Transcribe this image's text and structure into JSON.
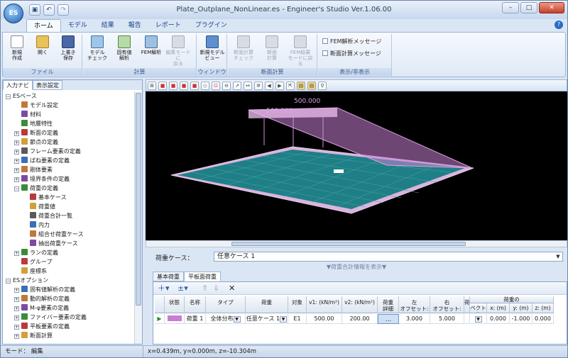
{
  "app": {
    "icon": "ES",
    "title": "Plate_Outplane_NonLinear.es - Engineer's Studio Ver.1.06.00"
  },
  "window_controls": {
    "minimize": "–",
    "maximize": "□",
    "close": "✕"
  },
  "quick_access": [
    "save-icon",
    "undo-icon",
    "redo-icon"
  ],
  "tabs": [
    "ホーム",
    "モデル",
    "結果",
    "報告",
    "レポート",
    "プラグイン"
  ],
  "ribbon": {
    "file": {
      "caption": "ファイル",
      "new": "新規\n作成",
      "open": "開く",
      "save": "上書き\n保存"
    },
    "calc": {
      "caption": "計算",
      "model_check": "モデル\nチェック",
      "eigen": "固有値\n解析",
      "fem": "FEM解析",
      "back_edit": "編集モードに\n戻る"
    },
    "window": {
      "caption": "ウィンドウ",
      "new_view": "新規モデル\nビュー"
    },
    "section": {
      "caption": "断面計算",
      "check": "断面計算\nチェック",
      "calc": "断面\n計算",
      "fem_back": "FEM結果\nモードに戻る"
    },
    "display": {
      "caption": "表示/非表示",
      "fem_msg": "FEM解析メッセージ",
      "sec_msg": "断面計算メッセージ"
    }
  },
  "left_panel": {
    "tabs": [
      "入力ナビ",
      "表示設定"
    ],
    "tree": [
      {
        "label": "ESベース",
        "level": 0,
        "exp": "−"
      },
      {
        "label": "モデル設定",
        "level": 1,
        "exp": ""
      },
      {
        "label": "材料",
        "level": 1,
        "exp": ""
      },
      {
        "label": "地層特性",
        "level": 1,
        "exp": ""
      },
      {
        "label": "断面の定義",
        "level": 1,
        "exp": "+"
      },
      {
        "label": "節点の定義",
        "level": 1,
        "exp": "+"
      },
      {
        "label": "フレーム要素の定義",
        "level": 1,
        "exp": "+"
      },
      {
        "label": "ばね要素の定義",
        "level": 1,
        "exp": "+"
      },
      {
        "label": "剛体要素",
        "level": 1,
        "exp": "+"
      },
      {
        "label": "境界条件の定義",
        "level": 1,
        "exp": "+"
      },
      {
        "label": "荷重の定義",
        "level": 1,
        "exp": "−"
      },
      {
        "label": "基本ケース",
        "level": 2,
        "exp": ""
      },
      {
        "label": "荷重値",
        "level": 2,
        "exp": ""
      },
      {
        "label": "荷重合計一覧",
        "level": 2,
        "exp": ""
      },
      {
        "label": "内力",
        "level": 2,
        "exp": ""
      },
      {
        "label": "組合せ荷重ケース",
        "level": 2,
        "exp": ""
      },
      {
        "label": "抽出荷重ケース",
        "level": 2,
        "exp": ""
      },
      {
        "label": "ランの定義",
        "level": 1,
        "exp": "+"
      },
      {
        "label": "グループ",
        "level": 1,
        "exp": ""
      },
      {
        "label": "座標系",
        "level": 1,
        "exp": ""
      },
      {
        "label": "ESオプション",
        "level": 0,
        "exp": "−"
      },
      {
        "label": "固有値解析の定義",
        "level": 1,
        "exp": "+"
      },
      {
        "label": "動的解析の定義",
        "level": 1,
        "exp": "+"
      },
      {
        "label": "M-φ要素の定義",
        "level": 1,
        "exp": "+"
      },
      {
        "label": "ファイバー要素の定義",
        "level": 1,
        "exp": "+"
      },
      {
        "label": "平板要素の定義",
        "level": 1,
        "exp": "+"
      },
      {
        "label": "断面計算",
        "level": 1,
        "exp": "+"
      }
    ]
  },
  "viewport": {
    "load1": "500.000",
    "load2": "500.000"
  },
  "load_case": {
    "label": "荷重ケース：",
    "value": "任意ケース 1",
    "summary": "▼荷重合計情報を表示▼"
  },
  "bottom_tabs": [
    "基本荷重",
    "平板面荷重"
  ],
  "table": {
    "headers": [
      "状態",
      "名称",
      "タイプ",
      "荷重",
      "対象",
      "v1: (kN/m²)",
      "v2: (kN/m²)",
      "荷重\n詳細",
      "左\nオフセット: (m)",
      "右\nオフセット: (m)",
      "荷",
      "ベクトル",
      "x: (m)",
      "y: (m)",
      "z: (m)"
    ],
    "group_header": "荷重の",
    "row": {
      "name": "荷重 1",
      "type": "全体分布",
      "load": "任意ケース 1",
      "target": "E1",
      "v1": "500.00",
      "v2": "200.00",
      "detail": "…",
      "left": "3.000",
      "right": "5.000",
      "x": "0.000",
      "y": "-1.000",
      "z": "0.000"
    }
  },
  "status": {
    "mode": "モード：  編集",
    "coords": "x=0.439m, y=0.000m, z=-10.304m"
  },
  "colors": {
    "plate": "#2a8d8c",
    "load": "#c77fd1",
    "accent": "#15428b"
  }
}
